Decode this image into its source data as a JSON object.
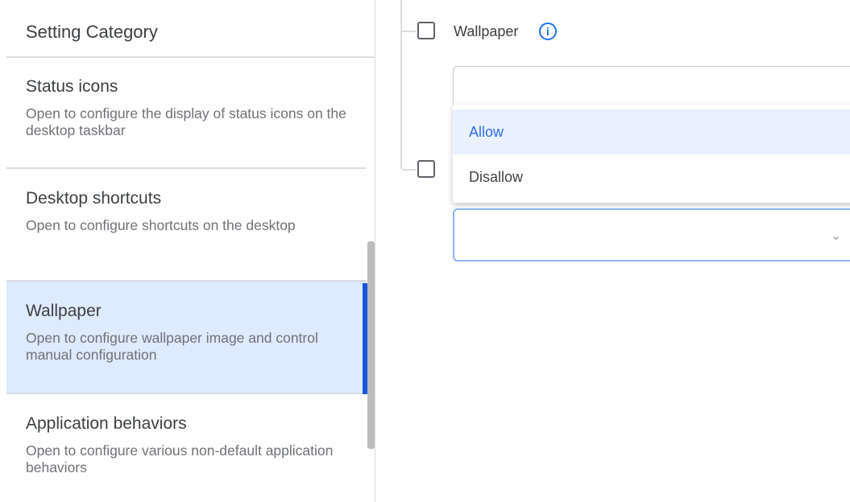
{
  "sidebar": {
    "header_title": "Setting Category",
    "items": [
      {
        "title": "Status icons",
        "description": "Open to configure the display of status icons on the desktop taskbar",
        "selected": false
      },
      {
        "title": "Desktop shortcuts",
        "description": "Open to configure shortcuts on the desktop",
        "selected": false
      },
      {
        "title": "Wallpaper",
        "description": "Open to configure wallpaper image and control manual configuration",
        "selected": true
      },
      {
        "title": "Application behaviors",
        "description": "Open to configure various non-default application behaviors",
        "selected": false
      }
    ]
  },
  "main": {
    "wallpaper_option": {
      "label": "Wallpaper",
      "info_icon": "info-icon",
      "checked": false
    },
    "dropdown": {
      "options": [
        "Allow",
        "Disallow"
      ],
      "highlighted": "Allow"
    },
    "second_checkbox": {
      "checked": false
    },
    "second_select": {
      "icon": "chevron-down-icon"
    }
  },
  "colors": {
    "accent": "#1a56db",
    "selected_bg": "#deeafd",
    "option_highlight": "#eaf1fe"
  }
}
